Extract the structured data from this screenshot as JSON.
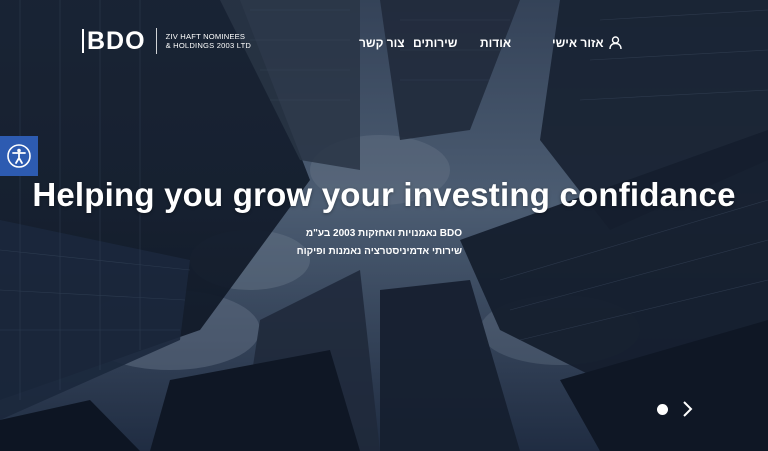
{
  "header": {
    "logo_text": "BDO",
    "company_line1": "ZIV HAFT NOMINEES",
    "company_line2": "& HOLDINGS 2003 LTD",
    "nav": {
      "personal_area": "אזור אישי",
      "about": "אודות",
      "services": "שירותים",
      "contact": "צור קשר"
    }
  },
  "accessibility": {
    "icon": "accessibility-icon"
  },
  "hero": {
    "title": "Helping you grow your investing confidance",
    "subtitle_line1": "BDO נאמנויות ואחזקות 2003 בע\"מ",
    "subtitle_line2": "שירותי אדמיניסטרציה נאמנות ופיקוח"
  },
  "carousel": {
    "next_icon": "chevron-right-icon",
    "dot_icon": "slide-dot"
  },
  "colors": {
    "accessibility_blue": "#2d5bb1",
    "overlay": "#1c2738"
  }
}
